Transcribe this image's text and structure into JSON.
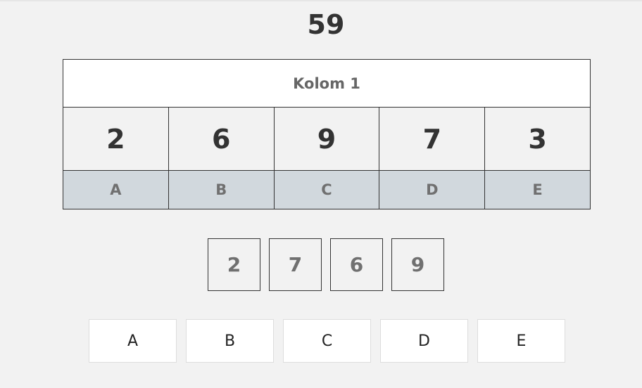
{
  "score": "59",
  "grid": {
    "header": "Kolom 1",
    "values": [
      "2",
      "6",
      "9",
      "7",
      "3"
    ],
    "labels": [
      "A",
      "B",
      "C",
      "D",
      "E"
    ]
  },
  "tiles": [
    "2",
    "7",
    "6",
    "9"
  ],
  "answers": [
    "A",
    "B",
    "C",
    "D",
    "E"
  ],
  "colors": {
    "background": "#f2f2f2",
    "label_row": "#d1d8dd",
    "border": "#333333"
  }
}
